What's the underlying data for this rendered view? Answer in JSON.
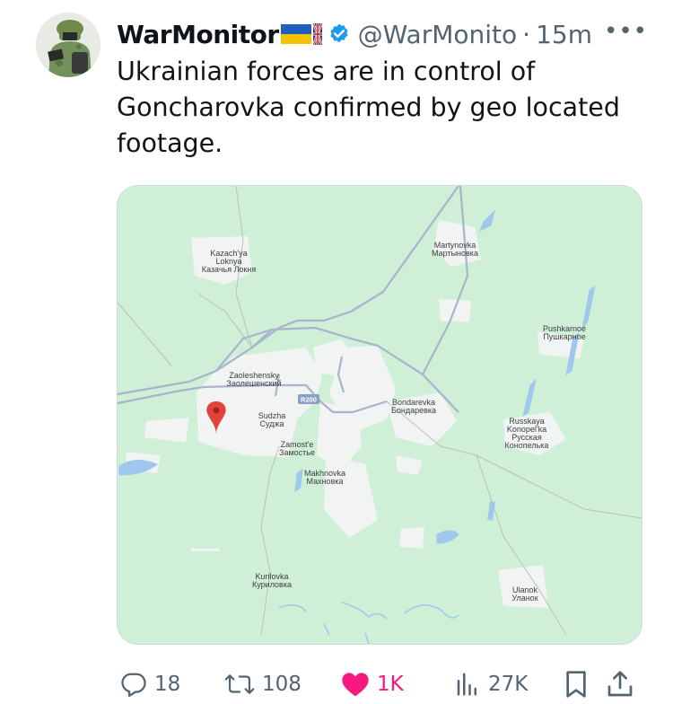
{
  "author": {
    "name": "WarMonitor",
    "flags": [
      "ukraine-flag-icon",
      "uk-flag-icon"
    ],
    "verified": true,
    "handle": "@WarMonito",
    "separator": "·",
    "time": "15m"
  },
  "menu": {
    "more_label": "•••"
  },
  "tweet": {
    "text": "Ukrainian forces are in control of Goncharovka confirmed by geo located footage."
  },
  "map": {
    "labels": [
      {
        "id": "kazachya",
        "lines": [
          "Kazach'ya",
          "Loknya",
          "Казачья Локня"
        ]
      },
      {
        "id": "martynovka",
        "lines": [
          "Martynovka",
          "Мартыновка"
        ]
      },
      {
        "id": "pushkarnoe",
        "lines": [
          "Pushkarnoe",
          "Пушкарное"
        ]
      },
      {
        "id": "zaoleshensky",
        "lines": [
          "Zaoleshensky",
          "Заолешенский"
        ]
      },
      {
        "id": "sudzha",
        "lines": [
          "Sudzha",
          "Суджа"
        ]
      },
      {
        "id": "bondarevka",
        "lines": [
          "Bondarevka",
          "Бондаревка"
        ]
      },
      {
        "id": "russkaya",
        "lines": [
          "Russkaya",
          "Konopel'ka",
          "Русская",
          "Конопелька"
        ]
      },
      {
        "id": "zamoste",
        "lines": [
          "Zamost'e",
          "Замостье"
        ]
      },
      {
        "id": "makhnovka",
        "lines": [
          "Makhnovka",
          "Махновка"
        ]
      },
      {
        "id": "kurilovka",
        "lines": [
          "Kurilovka",
          "Куриловка"
        ]
      },
      {
        "id": "ulanok",
        "lines": [
          "Ulanok",
          "Уланок"
        ]
      }
    ],
    "road_shield": "R200",
    "colors": {
      "land": "#cfefd6",
      "urban": "#f2f4f3",
      "water": "#9fc8ee",
      "road": "#a7b4cc",
      "pin": "#e0443a"
    }
  },
  "actions": {
    "replies": "18",
    "reposts": "108",
    "likes": "1K",
    "views": "27K"
  },
  "colors": {
    "text": "#0f1419",
    "secondary": "#536471",
    "verified": "#1d9bf0",
    "like": "#f91880",
    "border": "#cfd9de"
  }
}
